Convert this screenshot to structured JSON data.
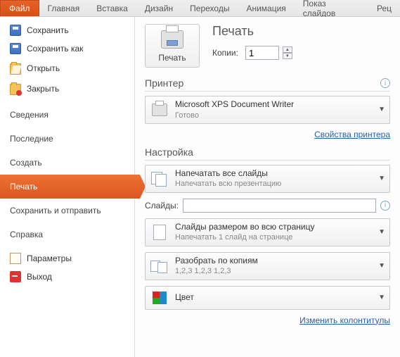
{
  "ribbon": {
    "tabs": [
      "Файл",
      "Главная",
      "Вставка",
      "Дизайн",
      "Переходы",
      "Анимация",
      "Показ слайдов",
      "Рец"
    ]
  },
  "sidebar": {
    "top": [
      {
        "label": "Сохранить"
      },
      {
        "label": "Сохранить как"
      },
      {
        "label": "Открыть"
      },
      {
        "label": "Закрыть"
      }
    ],
    "sections": [
      "Сведения",
      "Последние",
      "Создать",
      "Печать",
      "Сохранить и отправить",
      "Справка"
    ],
    "bottom": [
      {
        "label": "Параметры"
      },
      {
        "label": "Выход"
      }
    ]
  },
  "print": {
    "heading": "Печать",
    "button": "Печать",
    "copies_label": "Копии:",
    "copies_value": "1"
  },
  "printer": {
    "heading": "Принтер",
    "name": "Microsoft XPS Document Writer",
    "status": "Готово",
    "props_link": "Свойства принтера"
  },
  "settings": {
    "heading": "Настройка",
    "all_slides": {
      "t": "Напечатать все слайды",
      "s": "Напечатать всю презентацию"
    },
    "slides_label": "Слайды:",
    "fullpage": {
      "t": "Слайды размером во всю страницу",
      "s": "Напечатать 1 слайд на странице"
    },
    "collate": {
      "t": "Разобрать по копиям",
      "s": "1,2,3   1,2,3   1,2,3"
    },
    "color": {
      "t": "Цвет"
    },
    "footer_link": "Изменить колонтитулы"
  }
}
